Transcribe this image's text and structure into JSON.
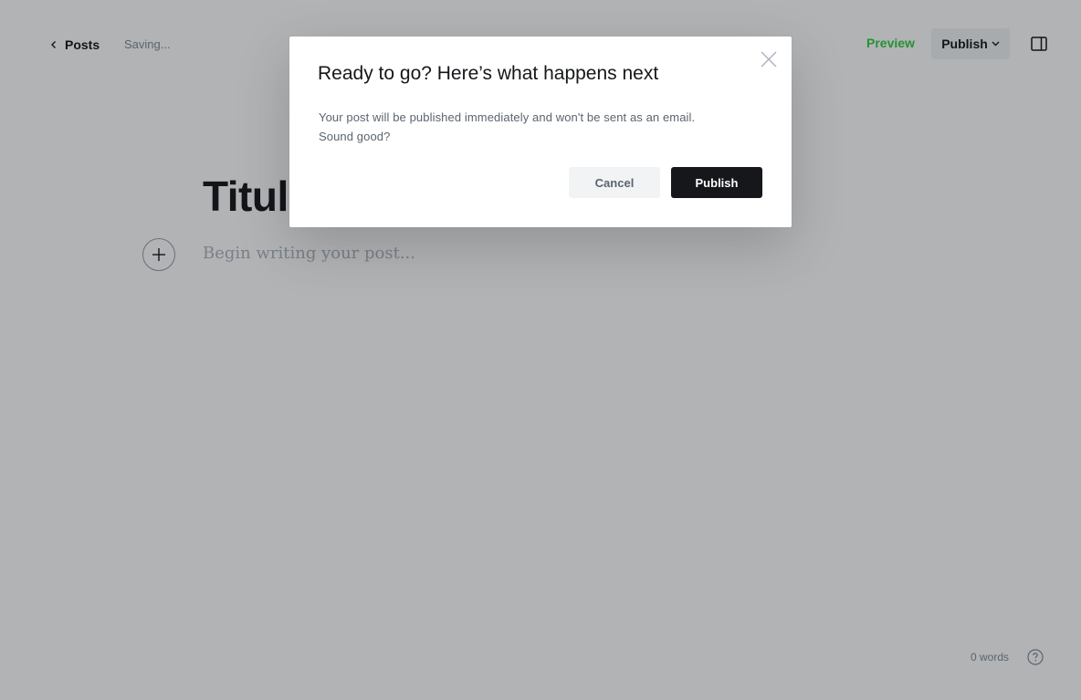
{
  "topbar": {
    "back_label": "Posts",
    "status": "Saving...",
    "preview_label": "Preview",
    "publish_label": "Publish"
  },
  "editor": {
    "title": "Titulo post de prueba",
    "body_placeholder": "Begin writing your post..."
  },
  "footer": {
    "word_count": "0 words"
  },
  "modal": {
    "title": "Ready to go? Here’s what happens next",
    "body_line1": "Your post will be published immediately and won't be sent as an email.",
    "body_line2": "Sound good?",
    "cancel_label": "Cancel",
    "publish_label": "Publish"
  },
  "icons": {
    "back": "chevron-left-icon",
    "publish_dropdown": "chevron-down-icon",
    "settings": "sidebar-toggle-icon",
    "add_card": "plus-icon",
    "help": "question-circle-icon",
    "close": "close-icon"
  },
  "colors": {
    "accent_green": "#30cf43",
    "primary_dark": "#15171a",
    "muted_text": "#7c8b9a"
  }
}
